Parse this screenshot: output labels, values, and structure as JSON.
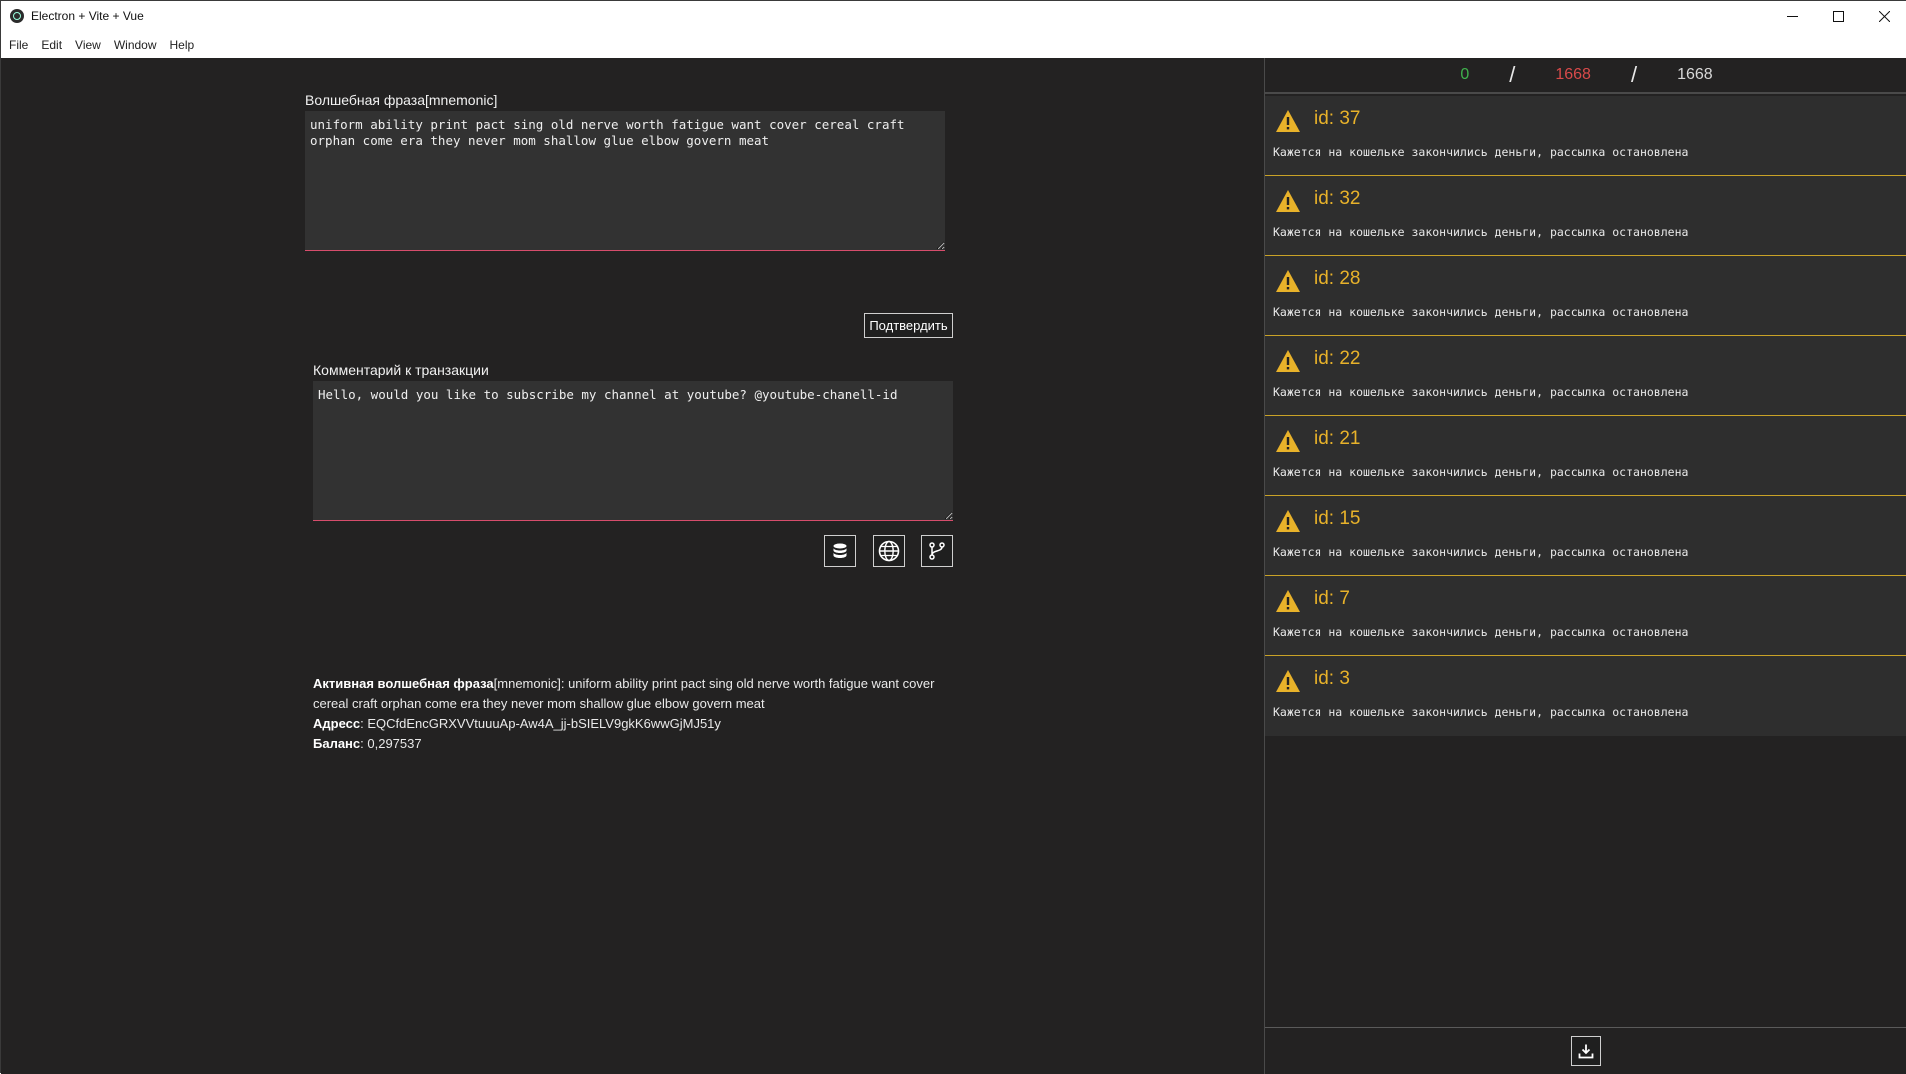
{
  "window": {
    "title": "Electron + Vite + Vue",
    "controls": {
      "minimize": "—",
      "maximize": "☐",
      "close": "✕"
    }
  },
  "menu": [
    "File",
    "Edit",
    "View",
    "Window",
    "Help"
  ],
  "mnemonic": {
    "label": "Волшебная фраза[mnemonic]",
    "value": "uniform ability print pact sing old nerve worth fatigue want cover cereal craft orphan come era they never mom shallow glue elbow govern meat",
    "confirm_label": "Подтвердить"
  },
  "comment": {
    "label": "Комментарий к транзакции",
    "value": "Hello, would you like to subscribe my channel at youtube? @youtube-chanell-id"
  },
  "actions": {
    "icons": [
      "database-icon",
      "globe-icon",
      "git-branch-icon"
    ]
  },
  "info": {
    "active_label": "Активная волшебная фраза",
    "active_suffix": "[mnemonic]: uniform ability print pact sing old nerve worth fatigue want cover cereal craft orphan come era they never mom shallow glue elbow govern meat",
    "address_label": "Адресс",
    "address_value": ": EQCfdEncGRXVVtuuuAp-Aw4A_jj-bSIELV9gkK6wwGjMJ51y",
    "balance_label": "Баланс",
    "balance_value": ": 0,297537"
  },
  "counter": {
    "success": "0",
    "failed": "1668",
    "total": "1668",
    "separator": "/"
  },
  "log": {
    "items": [
      {
        "id": "id: 37",
        "message": "Кажется на кошельке закончились деньги, рассылка остановлена"
      },
      {
        "id": "id: 32",
        "message": "Кажется на кошельке закончились деньги, рассылка остановлена"
      },
      {
        "id": "id: 28",
        "message": "Кажется на кошельке закончились деньги, рассылка остановлена"
      },
      {
        "id": "id: 22",
        "message": "Кажется на кошельке закончились деньги, рассылка остановлена"
      },
      {
        "id": "id: 21",
        "message": "Кажется на кошельке закончились деньги, рассылка остановлена"
      },
      {
        "id": "id: 15",
        "message": "Кажется на кошельке закончились деньги, рассылка остановлена"
      },
      {
        "id": "id: 7",
        "message": "Кажется на кошельке закончились деньги, рассылка остановлена"
      },
      {
        "id": "id: 3",
        "message": "Кажется на кошельке закончились деньги, рассылка остановлена"
      }
    ]
  },
  "colors": {
    "warning": "#e8b22a",
    "success": "#3fb24c",
    "danger": "#d84a4a",
    "accent_border": "#d64d6c"
  }
}
